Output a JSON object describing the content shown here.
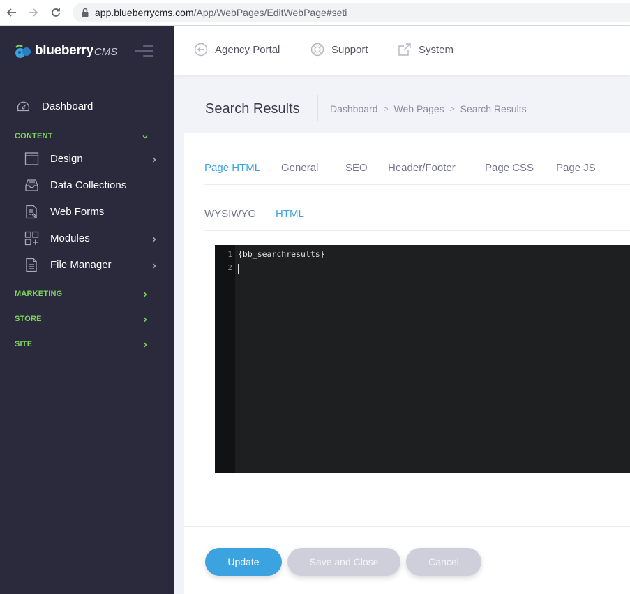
{
  "browser": {
    "url_host": "app.blueberrycms.com",
    "url_path": "/App/WebPages/EditWebPage#seti"
  },
  "brand": {
    "name": "blueberry",
    "suffix": "CMS"
  },
  "sidebar": {
    "dashboard": "Dashboard",
    "content_section": "CONTENT",
    "items": [
      {
        "label": "Design",
        "icon": "layout-icon",
        "has_children": true
      },
      {
        "label": "Data Collections",
        "icon": "inbox-icon",
        "has_children": false
      },
      {
        "label": "Web Forms",
        "icon": "form-icon",
        "has_children": false
      },
      {
        "label": "Modules",
        "icon": "modules-icon",
        "has_children": true
      },
      {
        "label": "File Manager",
        "icon": "file-icon",
        "has_children": true
      }
    ],
    "marketing_section": "MARKETING",
    "store_section": "STORE",
    "site_section": "SITE"
  },
  "topnav": {
    "agency_portal": "Agency Portal",
    "support": "Support",
    "system": "System"
  },
  "page": {
    "title": "Search Results",
    "breadcrumb": [
      "Dashboard",
      "Web Pages",
      "Search Results"
    ]
  },
  "tabs": [
    {
      "label": "Page HTML",
      "active": true
    },
    {
      "label": "General",
      "active": false
    },
    {
      "label": "SEO",
      "active": false
    },
    {
      "label": "Header/Footer",
      "active": false
    },
    {
      "label": "Page CSS",
      "active": false
    },
    {
      "label": "Page JS",
      "active": false
    }
  ],
  "subtabs": [
    {
      "label": "WYSIWYG",
      "active": false
    },
    {
      "label": "HTML",
      "active": true
    }
  ],
  "editor": {
    "line_numbers": [
      "1",
      "2"
    ],
    "lines": [
      "{bb_searchresults}",
      ""
    ]
  },
  "buttons": {
    "update": "Update",
    "save_close": "Save and Close",
    "cancel": "Cancel"
  },
  "colors": {
    "accent": "#3ba3e0",
    "sidebar_bg": "#2a2a3c",
    "section_green": "#7dd35c",
    "editor_bg": "#1d1f21"
  }
}
